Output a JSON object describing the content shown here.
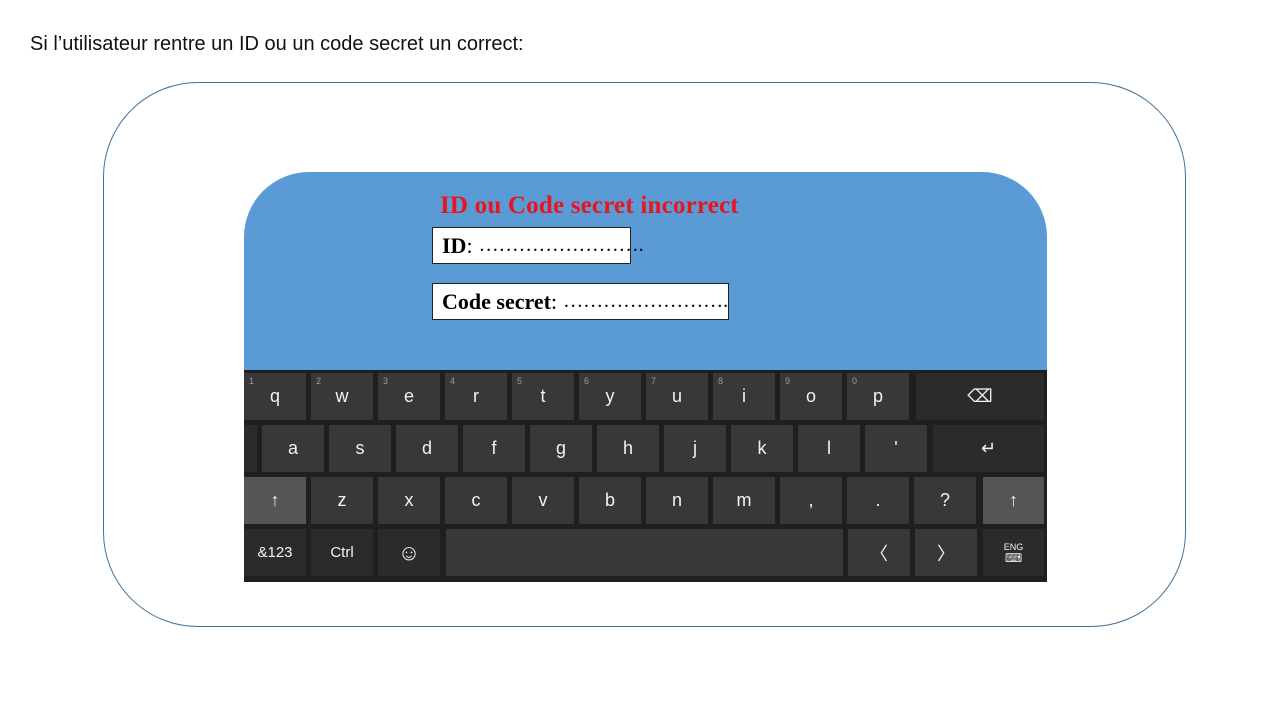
{
  "caption": "Si l’utilisateur rentre un ID ou un code secret un correct:",
  "error_message": "ID ou Code secret incorrect",
  "id_field": {
    "label": "ID",
    "separator": " :",
    "value": "……………………."
  },
  "code_field": {
    "label": "Code secret",
    "separator": " :",
    "value": "……………………."
  },
  "keyboard": {
    "row1": [
      {
        "label": "q",
        "num": "1"
      },
      {
        "label": "w",
        "num": "2"
      },
      {
        "label": "e",
        "num": "3"
      },
      {
        "label": "r",
        "num": "4"
      },
      {
        "label": "t",
        "num": "5"
      },
      {
        "label": "y",
        "num": "6"
      },
      {
        "label": "u",
        "num": "7"
      },
      {
        "label": "i",
        "num": "8"
      },
      {
        "label": "o",
        "num": "9"
      },
      {
        "label": "p",
        "num": "0"
      }
    ],
    "backspace": "⌫",
    "row2": [
      "a",
      "s",
      "d",
      "f",
      "g",
      "h",
      "j",
      "k",
      "l",
      "'"
    ],
    "enter": "↵",
    "row3": [
      "z",
      "x",
      "c",
      "v",
      "b",
      "n",
      "m",
      ",",
      ".",
      "?"
    ],
    "shift": "↑",
    "sym": "&123",
    "ctrl": "Ctrl",
    "emoji": "☺",
    "left": "〈",
    "right": "〉",
    "lang": "ENG",
    "lang_icon": "⌨",
    "colors": {
      "background": "#1f1f1f",
      "key": "#383838",
      "key_fn": "#2b2b2b",
      "key_shift": "#555555",
      "panel": "#5b9bd5",
      "error": "#e8141e"
    }
  }
}
